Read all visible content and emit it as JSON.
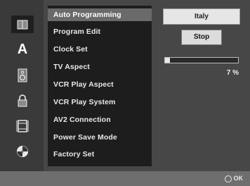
{
  "menu": {
    "items": [
      {
        "label": "Auto Programming",
        "selected": true
      },
      {
        "label": "Program Edit"
      },
      {
        "label": "Clock Set"
      },
      {
        "label": "TV Aspect"
      },
      {
        "label": "VCR Play Aspect"
      },
      {
        "label": "VCR Play System"
      },
      {
        "label": "AV2 Connection"
      },
      {
        "label": "Power Save Mode"
      },
      {
        "label": "Factory Set"
      }
    ]
  },
  "icons": [
    {
      "name": "book-icon",
      "selected": true
    },
    {
      "name": "language-a-icon"
    },
    {
      "name": "speaker-icon"
    },
    {
      "name": "lock-icon"
    },
    {
      "name": "film-strip-icon"
    },
    {
      "name": "disc-icon"
    }
  ],
  "settings": {
    "country_value": "Italy",
    "stop_label": "Stop",
    "progress_percent": 7,
    "progress_text": "7 %"
  },
  "footer": {
    "ok_label": "OK"
  }
}
